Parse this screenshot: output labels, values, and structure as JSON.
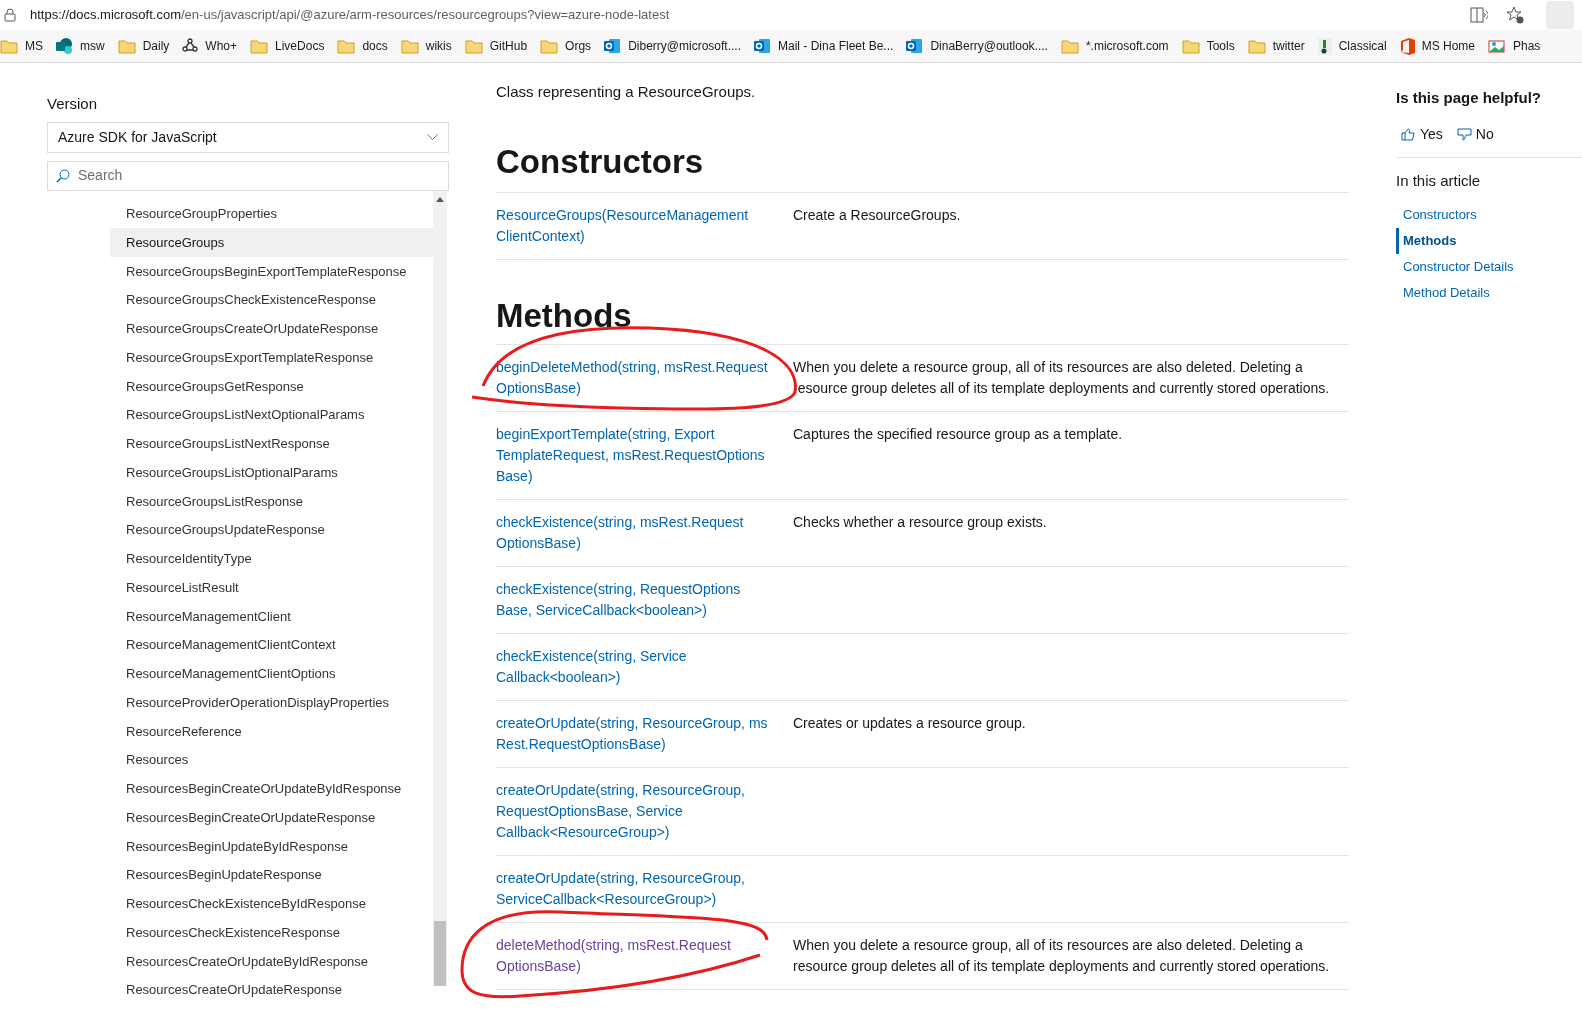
{
  "address_bar": {
    "url_host": "https://docs.microsoft.com",
    "url_path": "/en-us/javascript/api/@azure/arm-resources/resourcegroups?view=azure-node-latest"
  },
  "bookmarks": [
    {
      "kind": "folder",
      "label": "MS"
    },
    {
      "kind": "sharepoint",
      "label": "msw"
    },
    {
      "kind": "folder",
      "label": "Daily"
    },
    {
      "kind": "network",
      "label": "Who+"
    },
    {
      "kind": "folder",
      "label": "LiveDocs"
    },
    {
      "kind": "folder",
      "label": "docs"
    },
    {
      "kind": "folder",
      "label": "wikis"
    },
    {
      "kind": "folder",
      "label": "GitHub"
    },
    {
      "kind": "folder",
      "label": "Orgs"
    },
    {
      "kind": "outlook",
      "label": "Diberry@microsoft...."
    },
    {
      "kind": "outlook",
      "label": "Mail - Dina Fleet Be..."
    },
    {
      "kind": "outlook",
      "label": "DinaBerry@outlook...."
    },
    {
      "kind": "folder",
      "label": "*.microsoft.com"
    },
    {
      "kind": "folder",
      "label": "Tools"
    },
    {
      "kind": "folder",
      "label": "twitter"
    },
    {
      "kind": "tile",
      "label": "Classical"
    },
    {
      "kind": "office",
      "label": "MS Home"
    },
    {
      "kind": "image",
      "label": "Phas"
    }
  ],
  "sidebar": {
    "version_label": "Version",
    "version_value": "Azure SDK for JavaScript",
    "search_placeholder": "Search",
    "items": [
      {
        "label": "ResourceGroupProperties",
        "selected": false
      },
      {
        "label": "ResourceGroups",
        "selected": true
      },
      {
        "label": "ResourceGroupsBeginExportTemplateResponse",
        "selected": false
      },
      {
        "label": "ResourceGroupsCheckExistenceResponse",
        "selected": false
      },
      {
        "label": "ResourceGroupsCreateOrUpdateResponse",
        "selected": false
      },
      {
        "label": "ResourceGroupsExportTemplateResponse",
        "selected": false
      },
      {
        "label": "ResourceGroupsGetResponse",
        "selected": false
      },
      {
        "label": "ResourceGroupsListNextOptionalParams",
        "selected": false
      },
      {
        "label": "ResourceGroupsListNextResponse",
        "selected": false
      },
      {
        "label": "ResourceGroupsListOptionalParams",
        "selected": false
      },
      {
        "label": "ResourceGroupsListResponse",
        "selected": false
      },
      {
        "label": "ResourceGroupsUpdateResponse",
        "selected": false
      },
      {
        "label": "ResourceIdentityType",
        "selected": false
      },
      {
        "label": "ResourceListResult",
        "selected": false
      },
      {
        "label": "ResourceManagementClient",
        "selected": false
      },
      {
        "label": "ResourceManagementClientContext",
        "selected": false
      },
      {
        "label": "ResourceManagementClientOptions",
        "selected": false
      },
      {
        "label": "ResourceProviderOperationDisplayProperties",
        "selected": false
      },
      {
        "label": "ResourceReference",
        "selected": false
      },
      {
        "label": "Resources",
        "selected": false
      },
      {
        "label": "ResourcesBeginCreateOrUpdateByIdResponse",
        "selected": false
      },
      {
        "label": "ResourcesBeginCreateOrUpdateResponse",
        "selected": false
      },
      {
        "label": "ResourcesBeginUpdateByIdResponse",
        "selected": false
      },
      {
        "label": "ResourcesBeginUpdateResponse",
        "selected": false
      },
      {
        "label": "ResourcesCheckExistenceByIdResponse",
        "selected": false
      },
      {
        "label": "ResourcesCheckExistenceResponse",
        "selected": false
      },
      {
        "label": "ResourcesCreateOrUpdateByIdResponse",
        "selected": false
      },
      {
        "label": "ResourcesCreateOrUpdateResponse",
        "selected": false
      }
    ]
  },
  "content": {
    "intro": "Class representing a ResourceGroups.",
    "constructors_heading": "Constructors",
    "constructors": [
      {
        "lines": [
          "ResourceGroups(ResourceManagement",
          "ClientContext)"
        ],
        "visited": false,
        "description": "Create a ResourceGroups."
      }
    ],
    "methods_heading": "Methods",
    "methods": [
      {
        "lines": [
          "beginDeleteMethod(string, msRest.Request",
          "OptionsBase)"
        ],
        "visited": false,
        "description": "When you delete a resource group, all of its resources are also deleted. Deleting a resource group deletes all of its template deployments and currently stored operations."
      },
      {
        "lines": [
          "beginExportTemplate(string, Export",
          "TemplateRequest, msRest.RequestOptions",
          "Base)"
        ],
        "visited": false,
        "description": "Captures the specified resource group as a template."
      },
      {
        "lines": [
          "checkExistence(string, msRest.Request",
          "OptionsBase)"
        ],
        "visited": false,
        "description": "Checks whether a resource group exists."
      },
      {
        "lines": [
          "checkExistence(string, RequestOptions",
          "Base, ServiceCallback<boolean>)"
        ],
        "visited": false
      },
      {
        "lines": [
          "checkExistence(string, Service",
          "Callback<boolean>)"
        ],
        "visited": false
      },
      {
        "lines": [
          "createOrUpdate(string, ResourceGroup, ms",
          "Rest.RequestOptionsBase)"
        ],
        "visited": false,
        "description": "Creates or updates a resource group."
      },
      {
        "lines": [
          "createOrUpdate(string, ResourceGroup,",
          "RequestOptionsBase, Service",
          "Callback<ResourceGroup>)"
        ],
        "visited": false
      },
      {
        "lines": [
          "createOrUpdate(string, ResourceGroup,",
          "ServiceCallback<ResourceGroup>)"
        ],
        "visited": false
      },
      {
        "lines": [
          "deleteMethod(string, msRest.Request",
          "OptionsBase)"
        ],
        "visited": true,
        "description": "When you delete a resource group, all of its resources are also deleted. Deleting a resource group deletes all of its template deployments and currently stored operations."
      }
    ]
  },
  "right_rail": {
    "feedback_title": "Is this page helpful?",
    "yes": "Yes",
    "no": "No",
    "toc_title": "In this article",
    "toc": [
      {
        "label": "Constructors",
        "selected": false
      },
      {
        "label": "Methods",
        "selected": true
      },
      {
        "label": "Constructor Details",
        "selected": false
      },
      {
        "label": "Method Details",
        "selected": false
      }
    ]
  }
}
